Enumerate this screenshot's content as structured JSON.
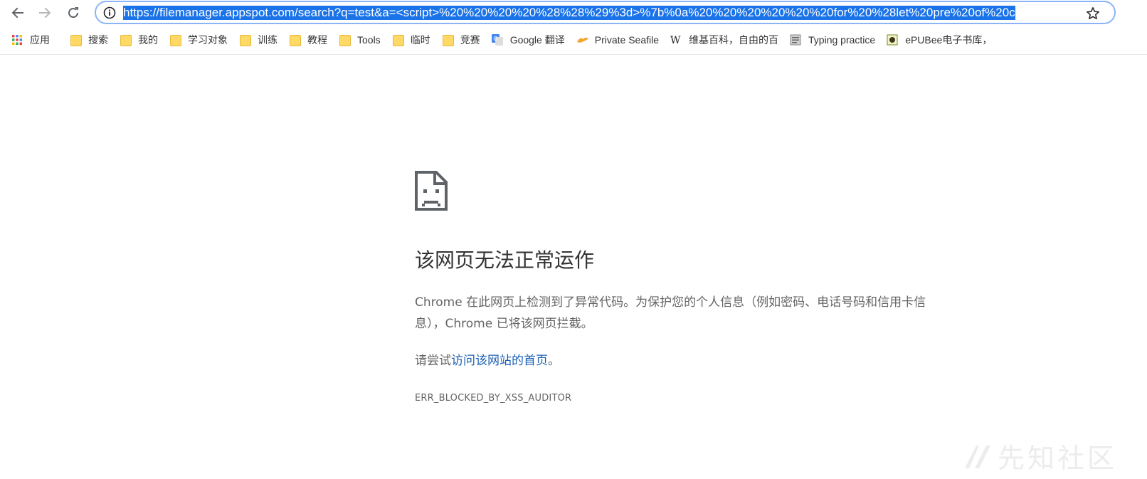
{
  "browser": {
    "url_full": "https://filemanager.appspot.com/search?q=test&a=<script>%20%20%20%20%28%28%29%3d>%7b%0a%20%20%20%20%20%20for%20%28let%20pre%20of%20c",
    "url_selected": true,
    "nav": {
      "back_icon": "arrow-left-icon",
      "forward_icon": "arrow-right-icon",
      "reload_icon": "reload-icon",
      "info_icon": "info-circle-icon",
      "star_icon": "star-icon"
    }
  },
  "bookmarks": [
    {
      "label": "应用",
      "icon": "apps-grid-icon"
    },
    {
      "label": "搜索",
      "icon": "folder-icon"
    },
    {
      "label": "我的",
      "icon": "folder-icon"
    },
    {
      "label": "学习对象",
      "icon": "folder-icon"
    },
    {
      "label": "训练",
      "icon": "folder-icon"
    },
    {
      "label": "教程",
      "icon": "folder-icon"
    },
    {
      "label": "Tools",
      "icon": "folder-icon"
    },
    {
      "label": "临时",
      "icon": "folder-icon"
    },
    {
      "label": "竞赛",
      "icon": "folder-icon"
    },
    {
      "label": "Google 翻译",
      "icon": "google-translate-icon"
    },
    {
      "label": "Private Seafile",
      "icon": "seafile-icon"
    },
    {
      "label": "维基百科，自由的百",
      "icon": "wikipedia-icon"
    },
    {
      "label": "Typing practice",
      "icon": "typing-icon"
    },
    {
      "label": "ePUBee电子书库，",
      "icon": "epubee-icon"
    }
  ],
  "error_page": {
    "icon": "sad-page-icon",
    "heading": "该网页无法正常运作",
    "description": "Chrome 在此网页上检测到了异常代码。为保护您的个人信息（例如密码、电话号码和信用卡信息），Chrome 已将该网页拦截。",
    "suggest_prefix": "请尝试",
    "suggest_link": "访问该网站的首页",
    "suggest_suffix": "。",
    "error_code": "ERR_BLOCKED_BY_XSS_AUDITOR"
  },
  "watermark": {
    "text": "先知社区",
    "icon": "xianzhi-logo-icon"
  },
  "colors": {
    "selection": "#1a73e8",
    "omnibox_focus": "#8ab4f8",
    "link": "#1a5fb4",
    "heading": "#333333",
    "body_text": "#646464",
    "folder": "#ffd965"
  }
}
